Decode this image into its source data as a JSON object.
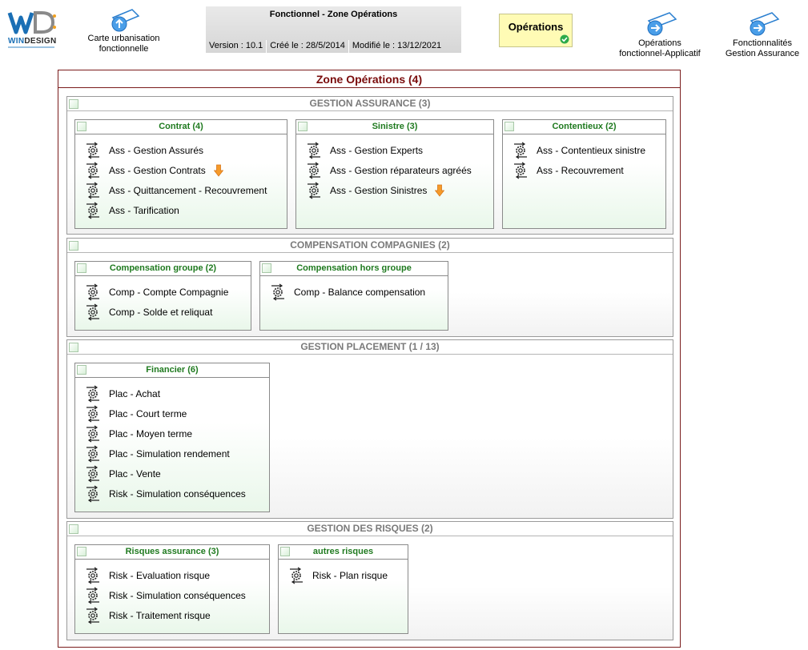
{
  "logo": {
    "part1": "WIN",
    "part2": "DESIGN"
  },
  "nav": {
    "carte": "Carte urbanisation fonctionnelle",
    "operations_applicatif": "Opérations fonctionnel-Applicatif",
    "fonctionnalites": "Fonctionnalités Gestion Assurance"
  },
  "header": {
    "title": "Fonctionnel - Zone Opérations",
    "version": "Version : 10.1",
    "created": "Créé le : 28/5/2014",
    "modified": "Modifié le : 13/12/2021"
  },
  "status": {
    "label": "Opérations"
  },
  "zone": {
    "title": "Zone Opérations (4)"
  },
  "sections": [
    {
      "title": "GESTION ASSURANCE (3)",
      "boxes": [
        {
          "title": "Contrat (4)",
          "items": [
            {
              "label": "Ass - Gestion Assurés"
            },
            {
              "label": "Ass - Gestion Contrats",
              "arrow": true
            },
            {
              "label": "Ass - Quittancement - Recouvrement"
            },
            {
              "label": "Ass - Tarification"
            }
          ]
        },
        {
          "title": "Sinistre (3)",
          "items": [
            {
              "label": "Ass - Gestion Experts"
            },
            {
              "label": "Ass - Gestion réparateurs agréés"
            },
            {
              "label": "Ass - Gestion Sinistres",
              "arrow": true
            }
          ]
        },
        {
          "title": "Contentieux (2)",
          "items": [
            {
              "label": "Ass - Contentieux sinistre"
            },
            {
              "label": "Ass - Recouvrement"
            }
          ]
        }
      ]
    },
    {
      "title": "COMPENSATION COMPAGNIES (2)",
      "boxes": [
        {
          "title": "Compensation groupe (2)",
          "items": [
            {
              "label": "Comp - Compte Compagnie"
            },
            {
              "label": "Comp - Solde et reliquat"
            }
          ]
        },
        {
          "title": "Compensation hors groupe",
          "items": [
            {
              "label": "Comp - Balance compensation"
            }
          ]
        }
      ]
    },
    {
      "title": "GESTION PLACEMENT (1 / 13)",
      "boxes": [
        {
          "title": "Financier (6)",
          "items": [
            {
              "label": "Plac - Achat"
            },
            {
              "label": "Plac - Court terme"
            },
            {
              "label": "Plac - Moyen terme"
            },
            {
              "label": "Plac - Simulation rendement"
            },
            {
              "label": "Plac - Vente"
            },
            {
              "label": "Risk - Simulation conséquences"
            }
          ]
        }
      ]
    },
    {
      "title": "GESTION DES RISQUES (2)",
      "boxes": [
        {
          "title": "Risques assurance (3)",
          "items": [
            {
              "label": "Risk - Evaluation risque"
            },
            {
              "label": "Risk - Simulation conséquences"
            },
            {
              "label": "Risk - Traitement risque"
            }
          ]
        },
        {
          "title": "autres risques",
          "items": [
            {
              "label": "Risk - Plan risque"
            }
          ]
        }
      ]
    }
  ]
}
